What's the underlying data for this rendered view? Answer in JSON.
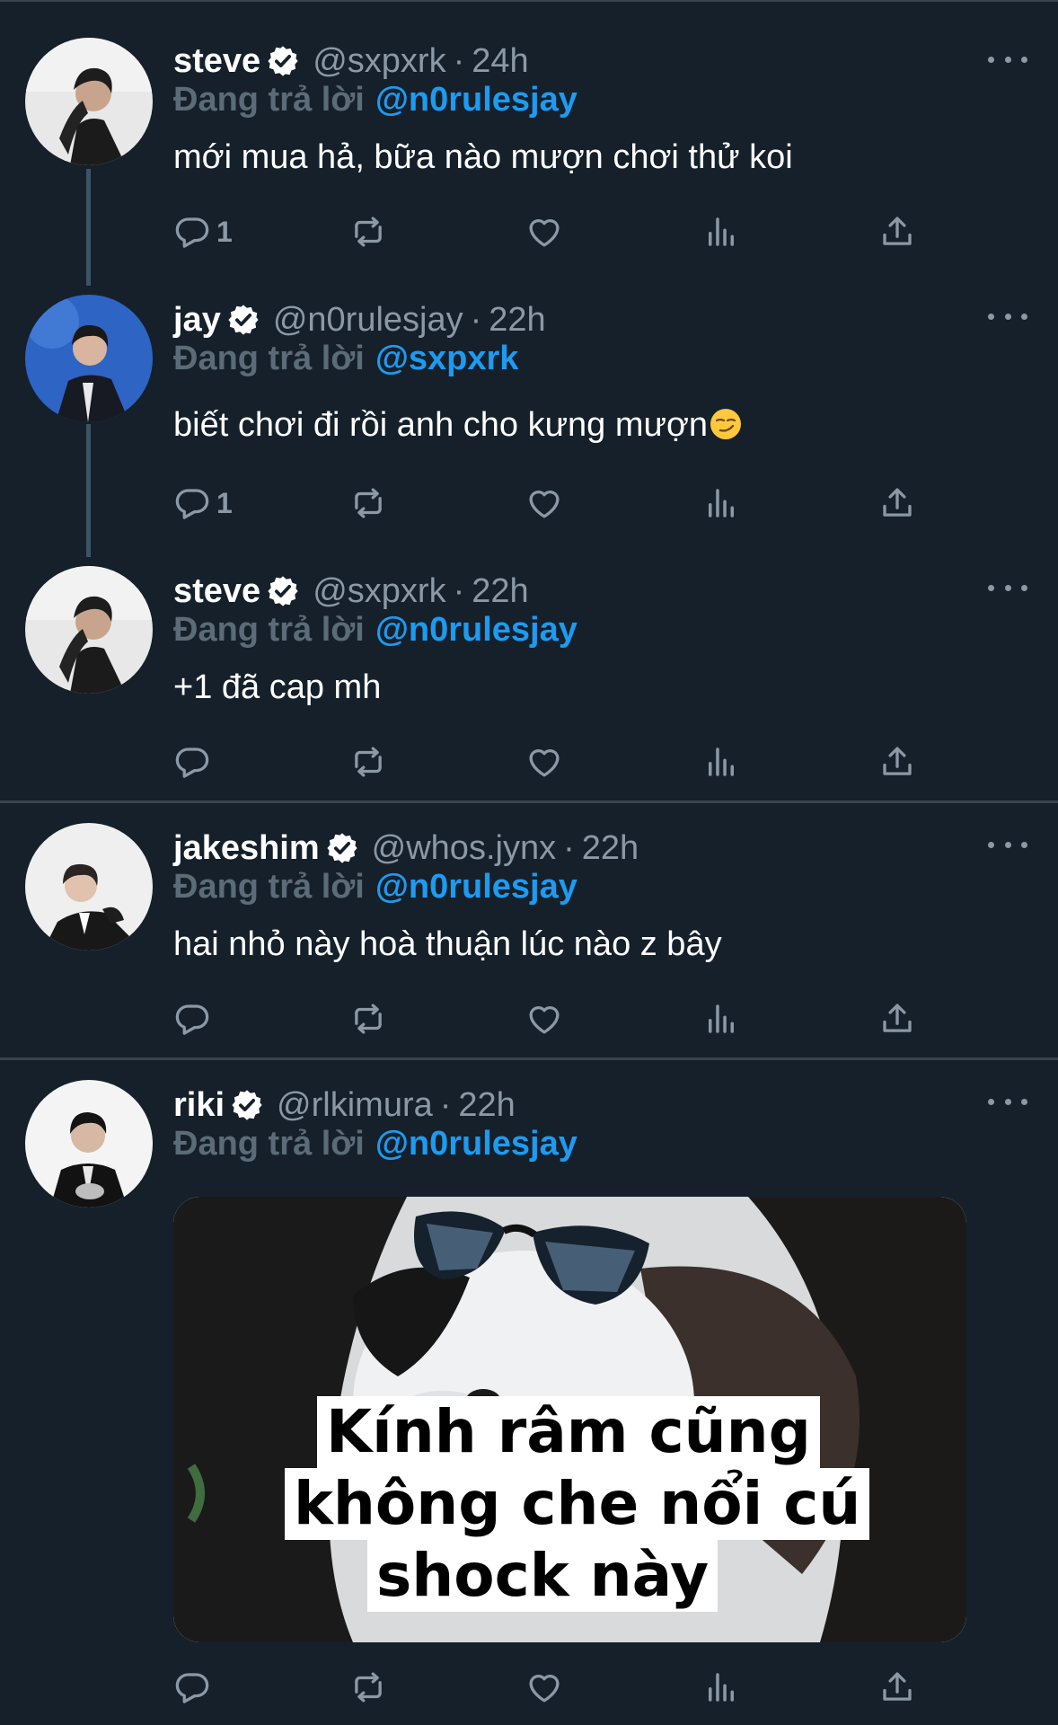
{
  "reply_prefix": "Đang trả lời",
  "tweets": [
    {
      "name": "steve",
      "handle": "@sxpxrk",
      "time": "24h",
      "reply_to": "@n0rulesjay",
      "text": "mới mua hả, bữa nào mượn chơi thử koi",
      "reply_count": "1",
      "avatar_icon": "avatar-steve"
    },
    {
      "name": "jay",
      "handle": "@n0rulesjay",
      "time": "22h",
      "reply_to": "@sxpxrk",
      "text": "biết chơi đi rồi anh cho kưng mượn",
      "emoji": "smirking-face-emoji",
      "reply_count": "1",
      "avatar_icon": "avatar-jay"
    },
    {
      "name": "steve",
      "handle": "@sxpxrk",
      "time": "22h",
      "reply_to": "@n0rulesjay",
      "text": "+1 đã cap mh",
      "reply_count": "",
      "avatar_icon": "avatar-steve"
    },
    {
      "name": "jakeshim",
      "handle": "@whos.jynx",
      "time": "22h",
      "reply_to": "@n0rulesjay",
      "text": "hai nhỏ này hoà thuận lúc nào z bây",
      "reply_count": "",
      "avatar_icon": "avatar-jakeshim"
    },
    {
      "name": "riki",
      "handle": "@rlkimura",
      "time": "22h",
      "reply_to": "@n0rulesjay",
      "text": "",
      "reply_count": "",
      "avatar_icon": "avatar-riki",
      "media": {
        "description_icon": "panda-sunglasses-meme-image",
        "caption_line1": "Kính râm cũng",
        "caption_line2": "không che nổi cú",
        "caption_line3": "shock này"
      }
    }
  ],
  "icons": {
    "reply": "reply-icon",
    "retweet": "retweet-icon",
    "like": "heart-icon",
    "views": "views-icon",
    "share": "share-icon",
    "more": "more-icon",
    "verified": "verified-badge-icon"
  },
  "colors": {
    "background": "#15202b",
    "link": "#1d9bf0",
    "muted": "#8b98a5",
    "divider": "#38444d"
  }
}
